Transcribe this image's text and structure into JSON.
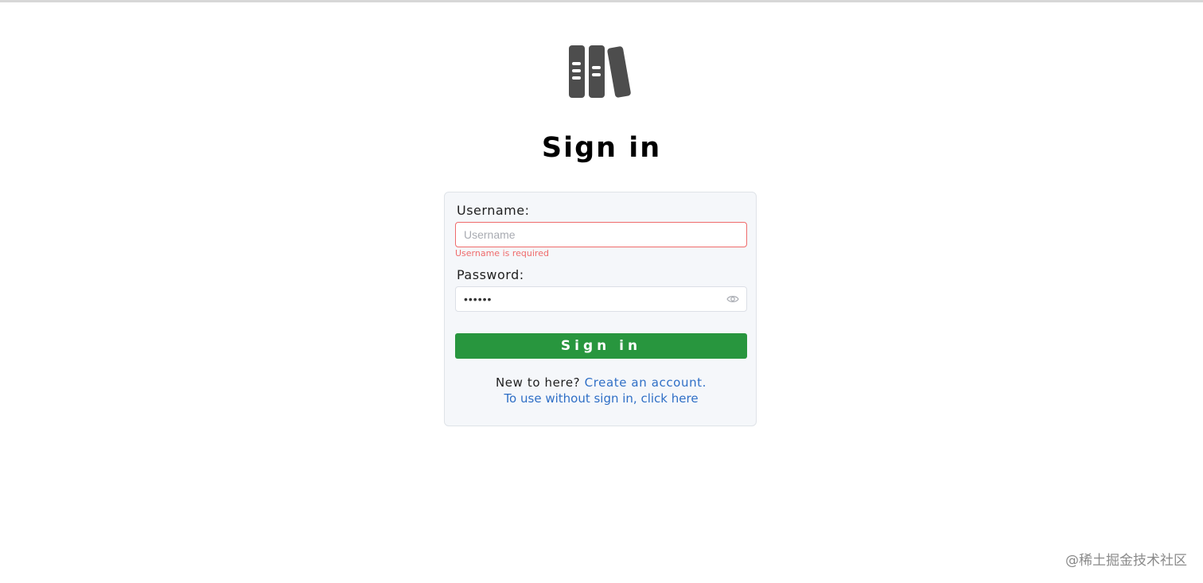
{
  "page": {
    "title": "Sign in",
    "logo_icon": "books-icon"
  },
  "form": {
    "username_label": "Username:",
    "username_placeholder": "Username",
    "username_value": "",
    "username_error": "Username is required",
    "password_label": "Password:",
    "password_value": "••••••",
    "password_toggle_icon": "eye-icon",
    "submit_label": "Sign in"
  },
  "footer": {
    "new_text": "New to here?",
    "create_link": "Create an account.",
    "guest_link": "To use without sign in, click here"
  },
  "watermark": "@稀土掘金技术社区",
  "colors": {
    "primary": "#28963e",
    "error": "#ef6b6b",
    "link": "#2f6fc6",
    "logo": "#4d4d4d"
  }
}
